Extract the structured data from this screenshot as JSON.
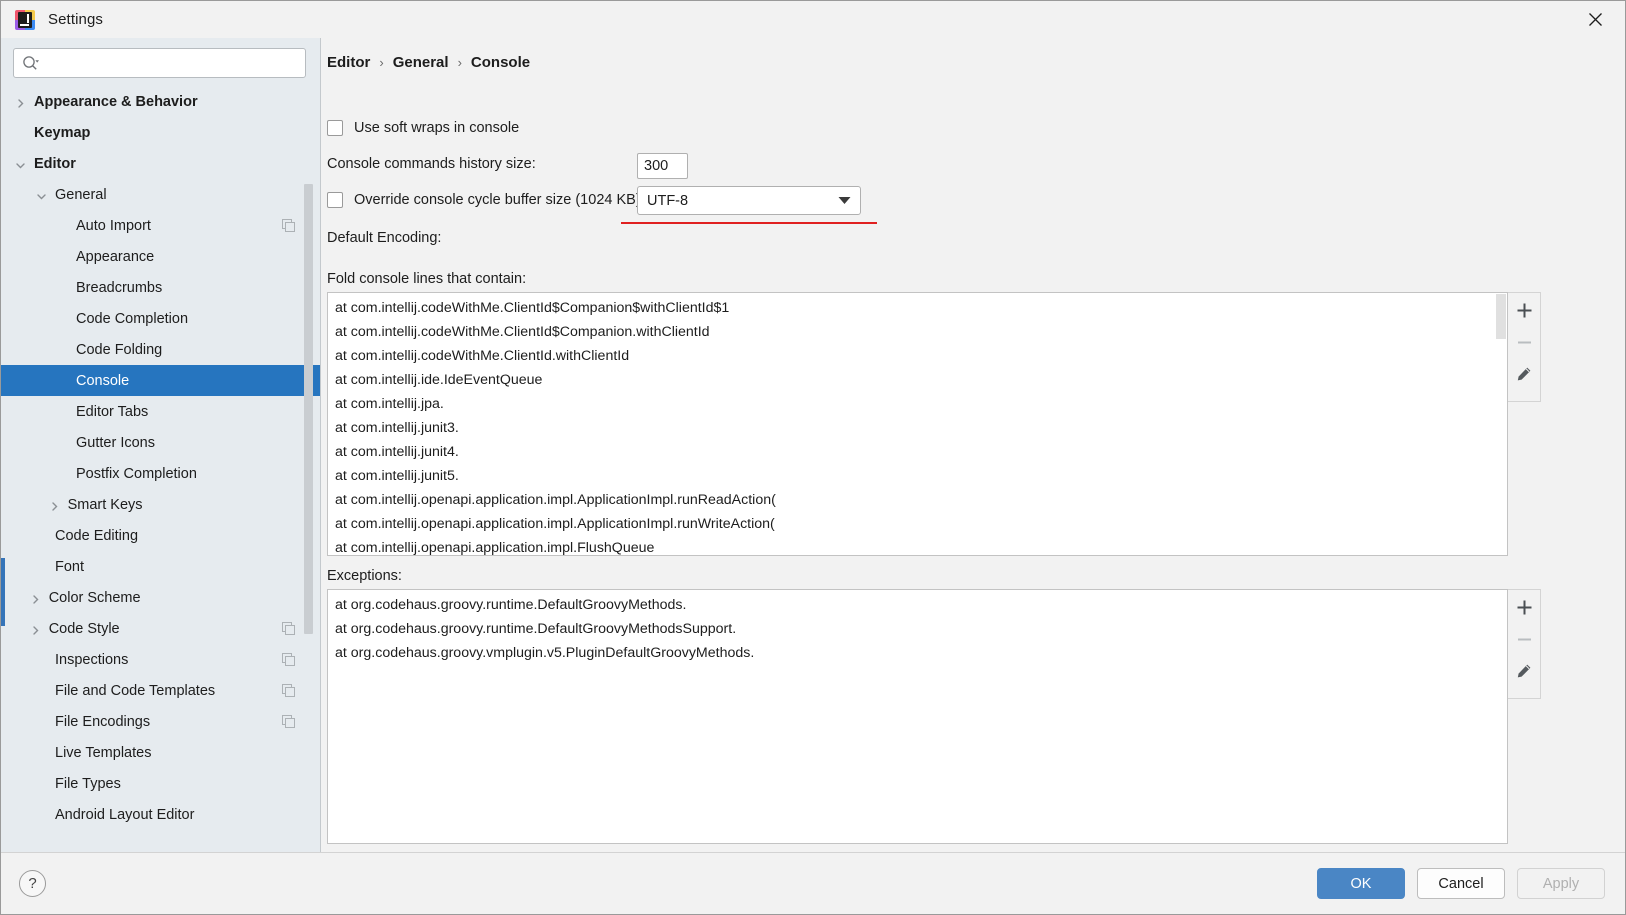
{
  "window": {
    "title": "Settings",
    "app_icon": "intellij-idea-icon",
    "close_label": "×"
  },
  "sidebar": {
    "search": {
      "placeholder": "",
      "value": "",
      "icon": "search-icon"
    },
    "items": [
      {
        "label": "Appearance & Behavior",
        "arrow": "right",
        "bold": true,
        "indent": 0,
        "copy": false
      },
      {
        "label": "Keymap",
        "arrow": "none",
        "bold": true,
        "indent": 0,
        "copy": false
      },
      {
        "label": "Editor",
        "arrow": "down",
        "bold": true,
        "indent": 0,
        "copy": false
      },
      {
        "label": "General",
        "arrow": "down",
        "bold": false,
        "indent": 1,
        "copy": false
      },
      {
        "label": "Auto Import",
        "arrow": "none",
        "bold": false,
        "indent": 2,
        "copy": true
      },
      {
        "label": "Appearance",
        "arrow": "none",
        "bold": false,
        "indent": 2,
        "copy": false
      },
      {
        "label": "Breadcrumbs",
        "arrow": "none",
        "bold": false,
        "indent": 2,
        "copy": false
      },
      {
        "label": "Code Completion",
        "arrow": "none",
        "bold": false,
        "indent": 2,
        "copy": false
      },
      {
        "label": "Code Folding",
        "arrow": "none",
        "bold": false,
        "indent": 2,
        "copy": false
      },
      {
        "label": "Console",
        "arrow": "none",
        "bold": false,
        "indent": 2,
        "copy": false,
        "selected": true
      },
      {
        "label": "Editor Tabs",
        "arrow": "none",
        "bold": false,
        "indent": 2,
        "copy": false
      },
      {
        "label": "Gutter Icons",
        "arrow": "none",
        "bold": false,
        "indent": 2,
        "copy": false
      },
      {
        "label": "Postfix Completion",
        "arrow": "none",
        "bold": false,
        "indent": 2,
        "copy": false
      },
      {
        "label": "Smart Keys",
        "arrow": "right",
        "bold": false,
        "indent": 1.6,
        "copy": false
      },
      {
        "label": "Code Editing",
        "arrow": "none",
        "bold": false,
        "indent": 1,
        "copy": false
      },
      {
        "label": "Font",
        "arrow": "none",
        "bold": false,
        "indent": 1,
        "copy": false
      },
      {
        "label": "Color Scheme",
        "arrow": "right",
        "bold": false,
        "indent": 0.7,
        "copy": false
      },
      {
        "label": "Code Style",
        "arrow": "right",
        "bold": false,
        "indent": 0.7,
        "copy": true
      },
      {
        "label": "Inspections",
        "arrow": "none",
        "bold": false,
        "indent": 1,
        "copy": true
      },
      {
        "label": "File and Code Templates",
        "arrow": "none",
        "bold": false,
        "indent": 1,
        "copy": true
      },
      {
        "label": "File Encodings",
        "arrow": "none",
        "bold": false,
        "indent": 1,
        "copy": true
      },
      {
        "label": "Live Templates",
        "arrow": "none",
        "bold": false,
        "indent": 1,
        "copy": false
      },
      {
        "label": "File Types",
        "arrow": "none",
        "bold": false,
        "indent": 1,
        "copy": false
      },
      {
        "label": "Android Layout Editor",
        "arrow": "none",
        "bold": false,
        "indent": 1,
        "copy": false
      }
    ]
  },
  "main": {
    "breadcrumb": [
      "Editor",
      "General",
      "Console"
    ],
    "breadcrumb_separator": "›",
    "soft_wraps": {
      "label": "Use soft wraps in console",
      "checked": false
    },
    "history_size": {
      "label": "Console commands history size:",
      "value": "300"
    },
    "override_buffer": {
      "label": "Override console cycle buffer size (1024 KB)",
      "checked": false,
      "value": "1024",
      "unit": "KB",
      "disabled": true
    },
    "default_encoding": {
      "label": "Default Encoding:",
      "value": "UTF-8",
      "highlight_color": "#e02020"
    },
    "fold_lines": {
      "title": "Fold console lines that contain:",
      "rows": [
        "at com.intellij.codeWithMe.ClientId$Companion$withClientId$1",
        "at com.intellij.codeWithMe.ClientId$Companion.withClientId",
        "at com.intellij.codeWithMe.ClientId.withClientId",
        "at com.intellij.ide.IdeEventQueue",
        "at com.intellij.jpa.",
        "at com.intellij.junit3.",
        "at com.intellij.junit4.",
        "at com.intellij.junit5.",
        "at com.intellij.openapi.application.impl.ApplicationImpl.runReadAction(",
        "at com.intellij.openapi.application.impl.ApplicationImpl.runWriteAction(",
        "at com.intellij.openapi.application.impl.FlushQueue"
      ],
      "toolbar": [
        {
          "name": "add-button",
          "glyph": "+",
          "enabled": true
        },
        {
          "name": "remove-button",
          "glyph": "−",
          "enabled": false
        },
        {
          "name": "edit-button",
          "glyph": "pencil",
          "enabled": true
        }
      ]
    },
    "exceptions": {
      "title": "Exceptions:",
      "rows": [
        "at org.codehaus.groovy.runtime.DefaultGroovyMethods.",
        "at org.codehaus.groovy.runtime.DefaultGroovyMethodsSupport.",
        "at org.codehaus.groovy.vmplugin.v5.PluginDefaultGroovyMethods."
      ],
      "toolbar": [
        {
          "name": "add-button",
          "glyph": "+",
          "enabled": true
        },
        {
          "name": "remove-button",
          "glyph": "−",
          "enabled": false
        },
        {
          "name": "edit-button",
          "glyph": "pencil",
          "enabled": true
        }
      ]
    }
  },
  "footer": {
    "help_label": "?",
    "ok_label": "OK",
    "cancel_label": "Cancel",
    "apply_label": "Apply",
    "accent_color": "#4a86c5"
  }
}
